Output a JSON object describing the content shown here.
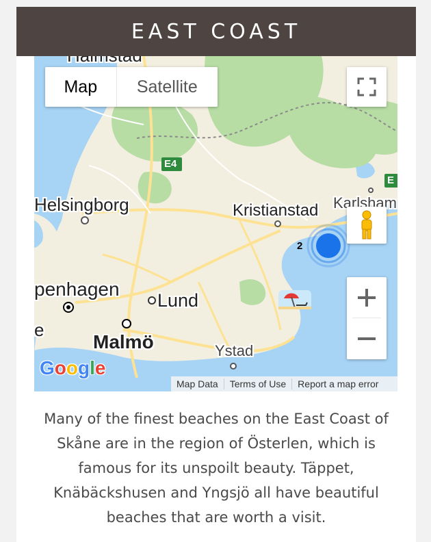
{
  "section": {
    "title": "EAST COAST"
  },
  "map": {
    "type_control": {
      "map_label": "Map",
      "satellite_label": "Satellite",
      "selected": "Map"
    },
    "labels": {
      "halmstad": "Halmstad",
      "helsingborg": "Helsingborg",
      "kristianstad": "Kristianstad",
      "karlshamn": "Karlsham",
      "copenhagen": "penhagen",
      "lund": "Lund",
      "malmo": "Malmö",
      "ystad": "Ystad",
      "e4": "E4",
      "e_east": "E",
      "cluster_count": "2",
      "edge_e": "e"
    },
    "logo": {
      "letters": [
        "G",
        "o",
        "o",
        "g",
        "l",
        "e"
      ],
      "colors": [
        "#4285F4",
        "#EA4335",
        "#FBBC05",
        "#4285F4",
        "#34A853",
        "#EA4335"
      ]
    },
    "attribution": [
      "Map Data",
      "Terms of Use",
      "Report a map error"
    ],
    "icons": [
      "fullscreen-icon",
      "pegman-icon",
      "zoom-in-icon",
      "zoom-out-icon",
      "beach-marker-icon",
      "location-marker-icon"
    ],
    "colors": {
      "water": "#a7d3f5",
      "land": "#f3efe0",
      "forest": "#b7dca4",
      "road": "#fde293",
      "marker": "#1a73e8",
      "header": "#4e4441"
    }
  },
  "description": "Many of the finest beaches on the East Coast of Skåne are in the region of Österlen, which is famous for its unspoilt beauty. Täppet, Knäbäckshusen and Yngsjö all have beautiful beaches that are worth a visit."
}
